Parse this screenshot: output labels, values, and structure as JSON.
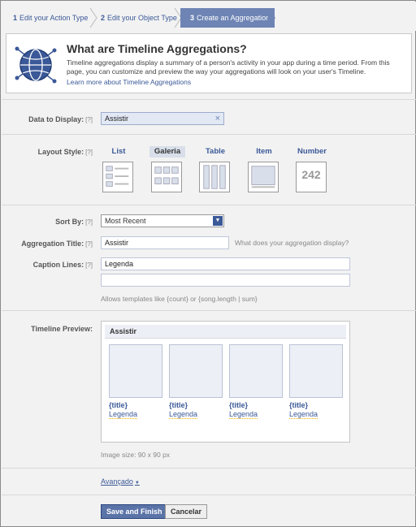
{
  "steps": [
    {
      "num": "1",
      "label": "Edit your Action Type"
    },
    {
      "num": "2",
      "label": "Edit your Object Type"
    },
    {
      "num": "3",
      "label": "Create an Aggregation"
    }
  ],
  "intro": {
    "title": "What are Timeline Aggregations?",
    "body": "Timeline aggregations display a summary of a person's activity in your app during a time period. From this page, you can customize and preview the way your aggregations will look on your user's Timeline.",
    "link": "Learn more about Timeline Aggregations"
  },
  "help_tag": "[?]",
  "data_to_display": {
    "label": "Data to Display:",
    "value": "Assistir",
    "remove": "×"
  },
  "layout_style": {
    "label": "Layout Style:",
    "options": [
      "List",
      "Galeria",
      "Table",
      "Item",
      "Number"
    ],
    "selected": "Galeria",
    "number_sample": "242"
  },
  "sort_by": {
    "label": "Sort By:",
    "value": "Most Recent"
  },
  "aggregation_title": {
    "label": "Aggregation Title:",
    "value": "Assistir",
    "hint": "What does your aggregation display?"
  },
  "caption_lines": {
    "label": "Caption Lines:",
    "line1": "Legenda",
    "line2": "",
    "hint": "Allows templates like {count} or {song.length | sum}"
  },
  "timeline_preview": {
    "label": "Timeline Preview:",
    "heading": "Assistir",
    "items": [
      {
        "title": "{title}",
        "caption": "Legenda"
      },
      {
        "title": "{title}",
        "caption": "Legenda"
      },
      {
        "title": "{title}",
        "caption": "Legenda"
      },
      {
        "title": "{title}",
        "caption": "Legenda"
      }
    ],
    "image_size": "Image size: 90 x 90 px"
  },
  "advanced_link": "Avançado",
  "buttons": {
    "save": "Save and Finish",
    "cancel": "Cancelar"
  },
  "colors": {
    "link": "#3b5998",
    "active_step": "#6d84b4",
    "primary_button": "#5b74a8"
  }
}
